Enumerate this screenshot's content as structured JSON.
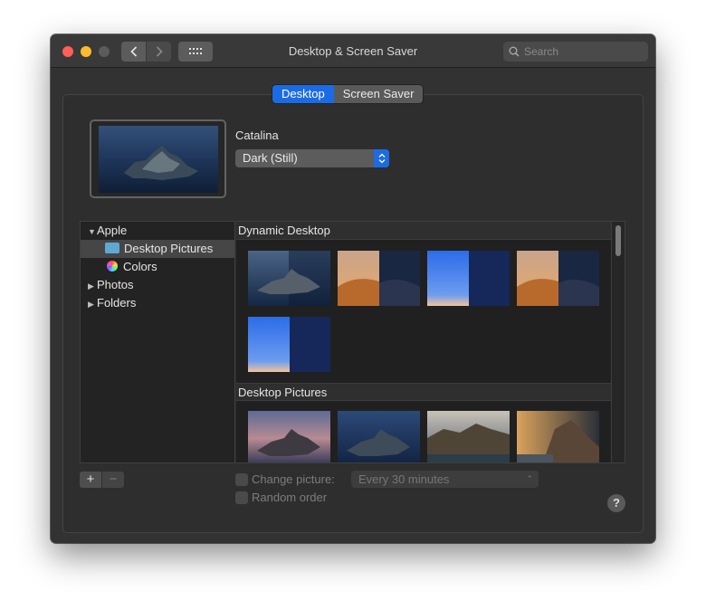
{
  "window": {
    "title": "Desktop & Screen Saver"
  },
  "search": {
    "placeholder": "Search"
  },
  "tabs": [
    {
      "label": "Desktop",
      "active": true
    },
    {
      "label": "Screen Saver",
      "active": false
    }
  ],
  "wallpaper": {
    "name": "Catalina",
    "mode": "Dark (Still)"
  },
  "sidebar": {
    "groups": [
      {
        "label": "Apple",
        "expanded": true,
        "children": [
          "Desktop Pictures",
          "Colors"
        ]
      },
      {
        "label": "Photos",
        "expanded": false
      },
      {
        "label": "Folders",
        "expanded": false
      }
    ],
    "selected": "Desktop Pictures"
  },
  "content": {
    "sections": [
      {
        "title": "Dynamic Desktop",
        "thumbnails": [
          "catalina",
          "mojave",
          "solar-gradient",
          "mojave",
          "solar-gradient"
        ]
      },
      {
        "title": "Desktop Pictures",
        "thumbnails": [
          "catalina-evening",
          "catalina-night",
          "catalina-day",
          "catalina-coast"
        ]
      }
    ]
  },
  "options": {
    "change_picture": {
      "label": "Change picture:",
      "checked": false,
      "interval": "Every 30 minutes"
    },
    "random_order": {
      "label": "Random order",
      "checked": false
    }
  },
  "buttons": {
    "add": "+",
    "remove": "−",
    "help": "?"
  },
  "colors": {
    "accent": "#1b6ce4",
    "window_bg": "#323232"
  }
}
